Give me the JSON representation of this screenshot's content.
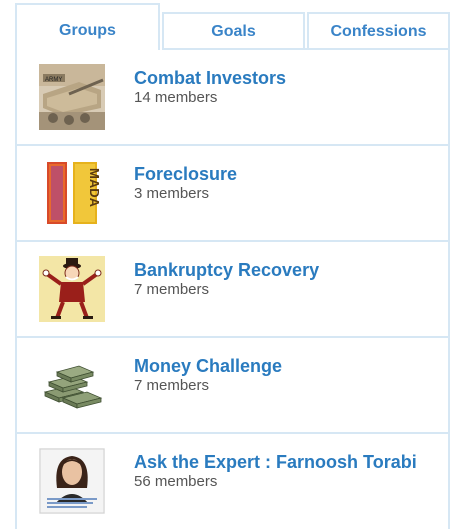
{
  "tabs": [
    {
      "label": "Groups",
      "active": true
    },
    {
      "label": "Goals",
      "active": false
    },
    {
      "label": "Confessions",
      "active": false
    }
  ],
  "groups": [
    {
      "title": "Combat Investors",
      "members": "14 members",
      "icon": "tank-photo"
    },
    {
      "title": "Foreclosure",
      "members": "3 members",
      "icon": "mada-sign-photo"
    },
    {
      "title": "Bankruptcy Recovery",
      "members": "7 members",
      "icon": "monopoly-man-illustration"
    },
    {
      "title": "Money Challenge",
      "members": "7 members",
      "icon": "cash-stacks-photo"
    },
    {
      "title": "Ask the Expert : Farnoosh Torabi",
      "members": "56 members",
      "icon": "woman-portrait-photo"
    }
  ],
  "colors": {
    "accent": "#2a7bbf",
    "border": "#d6e7f4"
  }
}
